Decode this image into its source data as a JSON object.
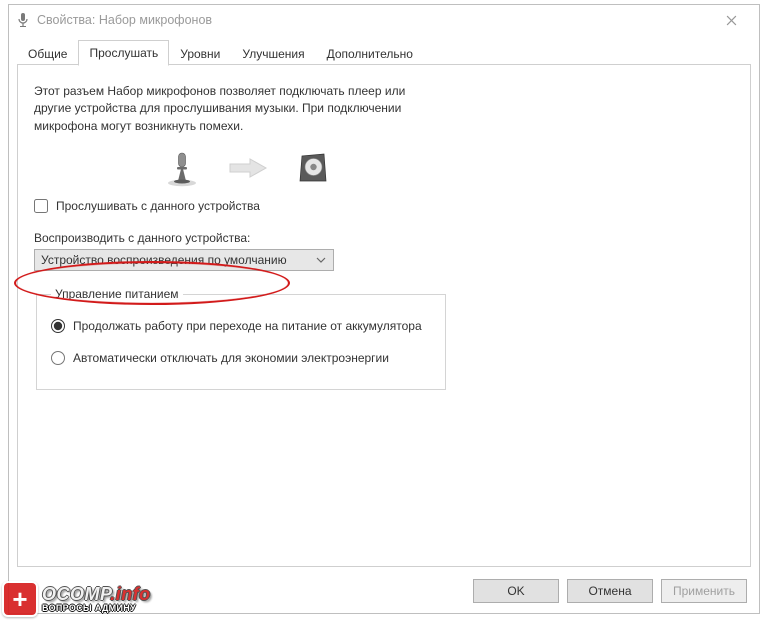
{
  "window": {
    "title": "Свойства: Набор микрофонов"
  },
  "tabs": [
    {
      "label": "Общие"
    },
    {
      "label": "Прослушать"
    },
    {
      "label": "Уровни"
    },
    {
      "label": "Улучшения"
    },
    {
      "label": "Дополнительно"
    }
  ],
  "active_tab_index": 1,
  "description": "Этот разъем Набор микрофонов позволяет подключать плеер или другие устройства для прослушивания музыки. При подключении микрофона могут возникнуть помехи.",
  "listen_checkbox": {
    "label": "Прослушивать с данного устройства",
    "checked": false
  },
  "playback_label": "Воспроизводить с данного устройства:",
  "playback_selected": "Устройство воспроизведения по умолчанию",
  "power": {
    "legend": "Управление питанием",
    "opt_continue": "Продолжать работу при переходе на питание от аккумулятора",
    "opt_auto_off": "Автоматически отключать для экономии электроэнергии",
    "selected": "continue"
  },
  "buttons": {
    "ok": "OK",
    "cancel": "Отмена",
    "apply": "Применить"
  },
  "watermark": {
    "brand_main": "OCOMP",
    "brand_suffix": ".info",
    "subtitle": "ВОПРОСЫ АДМИНУ"
  }
}
